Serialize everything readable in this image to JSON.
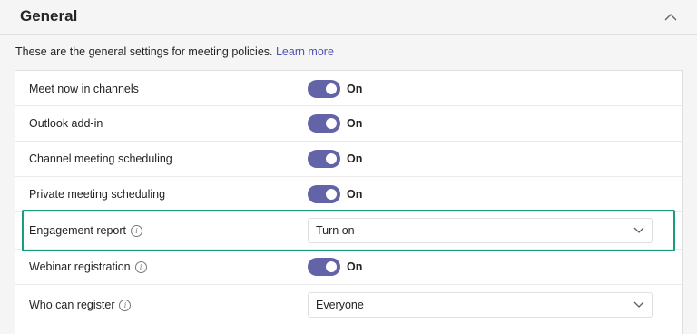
{
  "header": {
    "title": "General"
  },
  "description": {
    "text": "These are the general settings for meeting policies.",
    "link": "Learn more"
  },
  "rows": [
    {
      "label": "Meet now in channels",
      "state": "On"
    },
    {
      "label": "Outlook add-in",
      "state": "On"
    },
    {
      "label": "Channel meeting scheduling",
      "state": "On"
    },
    {
      "label": "Private meeting scheduling",
      "state": "On"
    },
    {
      "label": "Engagement report",
      "value": "Turn on"
    },
    {
      "label": "Webinar registration",
      "state": "On"
    },
    {
      "label": "Who can register",
      "value": "Everyone"
    }
  ],
  "info_icon_glyph": "i",
  "colors": {
    "accent": "#6264a7",
    "highlight": "#1a9c7e",
    "link": "#4f52b2"
  }
}
